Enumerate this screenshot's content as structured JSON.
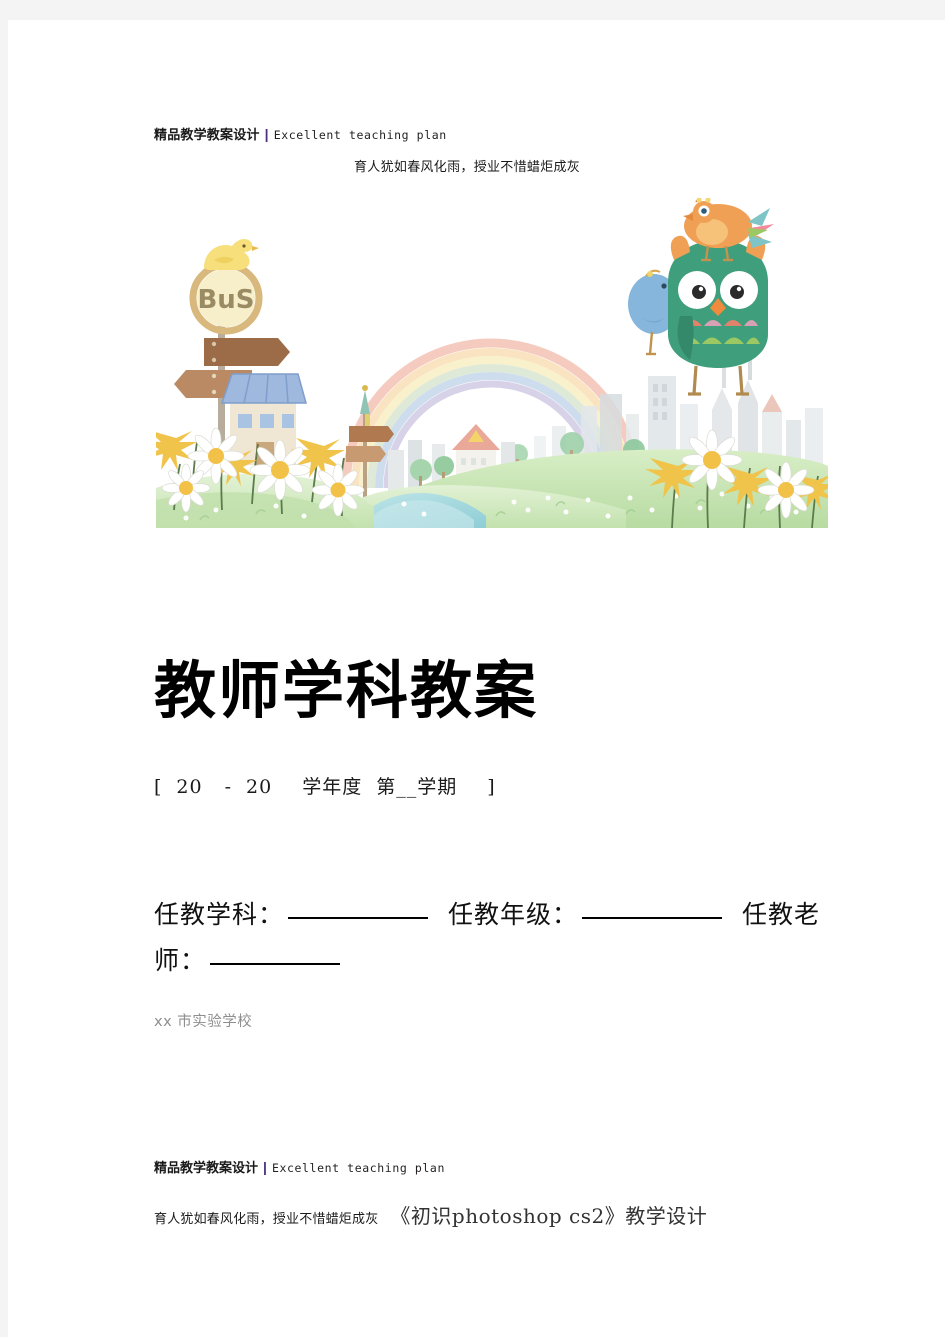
{
  "header": {
    "brand_cn": "精品教学教案设计",
    "separator": "|",
    "brand_en": "Excellent teaching plan",
    "motto": "育人犹如春风化雨，授业不惜蜡炬成灰"
  },
  "illustration": {
    "alt": "watercolor cityscape with bus sign, birds, owl, rainbow, daisies and river",
    "bus_sign_label": "BuS",
    "colors": {
      "grass": "#cfe8bd",
      "grass_dark": "#b8dca6",
      "river": "#a9dce0",
      "owl_green": "#3f9e7c",
      "bird_orange": "#f0a055",
      "bird_blue": "#7fb3dd",
      "bird_yellow": "#f7de7e",
      "sign_brown": "#a9764c",
      "rainbow_pink": "#f6c7bd",
      "rainbow_yellow": "#f6ecc0",
      "rainbow_blue": "#c5d8ea",
      "flower_yellow": "#f2c44a",
      "flower_white": "#ffffff",
      "city_gray": "#d9dde0"
    }
  },
  "title": "教师学科教案",
  "year_line": {
    "open_bracket": "[",
    "year_start": "20",
    "dash": "-",
    "year_end": "20",
    "term_label": "学年度",
    "semester_label": "第__学期",
    "close_bracket": "]"
  },
  "fields": [
    {
      "label": "任教学科：",
      "value": ""
    },
    {
      "label": "任教年级：",
      "value": ""
    },
    {
      "label": "任教老师：",
      "value": ""
    }
  ],
  "fields_flat": {
    "subject_label": "任教学科：",
    "grade_label": "任教年级：",
    "teacher_label_part1": "任",
    "teacher_label_part2": "教老师："
  },
  "school": "xx 市实验学校",
  "footer": {
    "brand_cn": "精品教学教案设计",
    "separator": "|",
    "brand_en": "Excellent teaching plan",
    "motto": "育人犹如春风化雨，授业不惜蜡炬成灰",
    "lesson_title": "《初识photoshop cs2》教学设计"
  }
}
